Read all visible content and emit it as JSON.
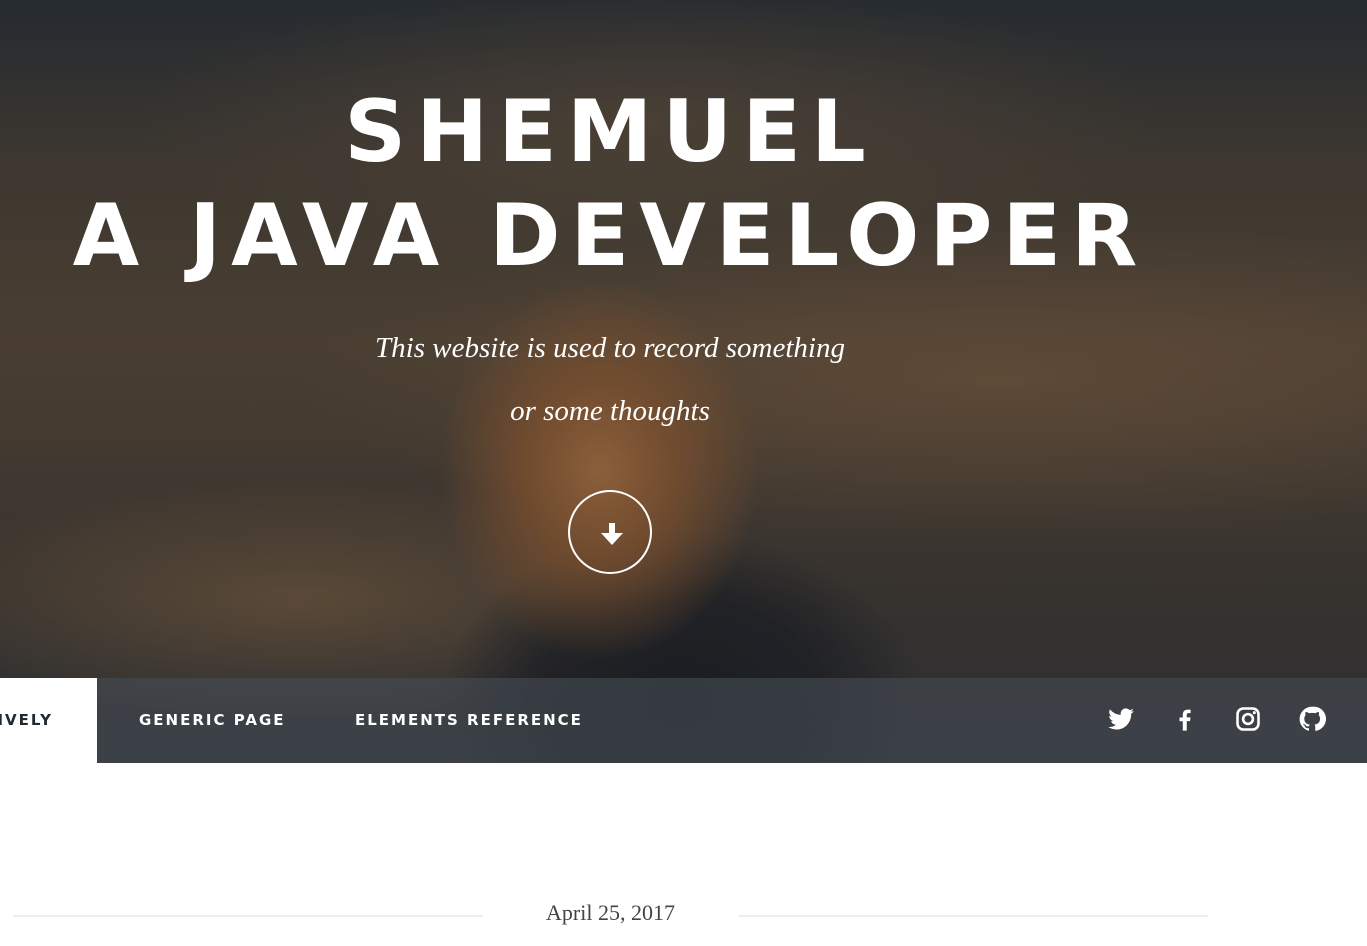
{
  "hero": {
    "title_line1": "SHEMUEL",
    "title_line2": "A JAVA DEVELOPER",
    "subtitle_line1": "This website is used to record something",
    "subtitle_line2": "or some thoughts",
    "scroll_icon": "arrow-down-icon"
  },
  "nav": {
    "items": [
      {
        "label": "SIVELY",
        "active": true
      },
      {
        "label": "GENERIC PAGE",
        "active": false
      },
      {
        "label": "ELEMENTS REFERENCE",
        "active": false
      }
    ],
    "social_icons": [
      "twitter-icon",
      "facebook-icon",
      "instagram-icon",
      "github-icon"
    ]
  },
  "post": {
    "date": "April 25, 2017"
  },
  "colors": {
    "text_light": "#ffffff",
    "text_dark": "#212931",
    "divider": "#eeeeee"
  }
}
